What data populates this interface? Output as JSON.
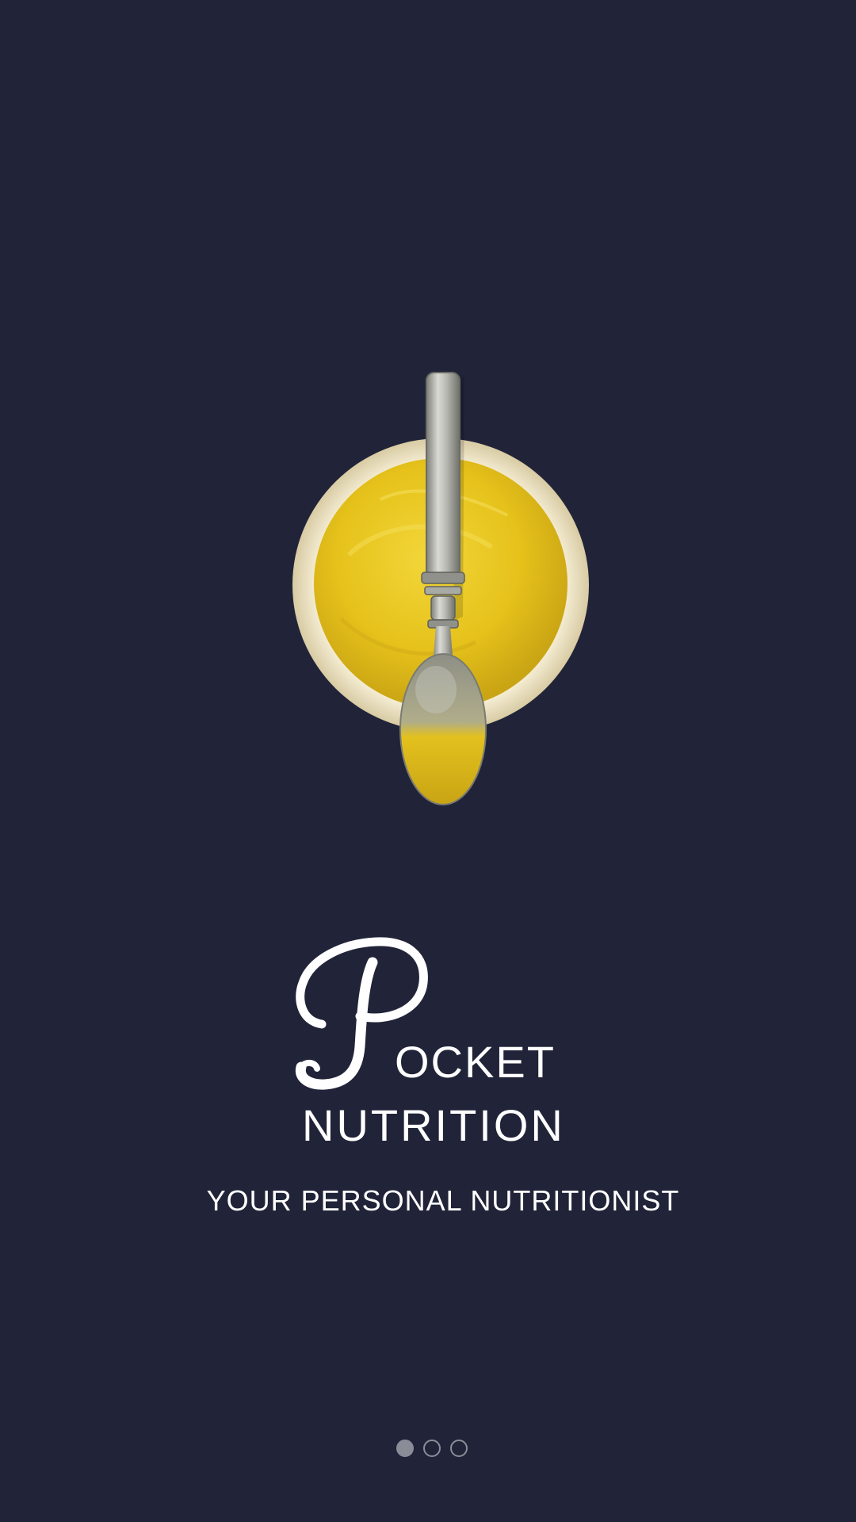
{
  "app": {
    "logo_initial": "P",
    "title_line1_rest": "OCKET",
    "title_line2": "NUTRITION",
    "tagline": "YOUR PERSONAL NUTRITIONIST"
  },
  "hero_image": {
    "subject": "bowl-of-mustard-with-spoon"
  },
  "pager": {
    "count": 3,
    "active_index": 0
  },
  "colors": {
    "background": "#212438",
    "text": "#ffffff",
    "dot": "#8a8c98",
    "mustard": "#e8c51c"
  }
}
